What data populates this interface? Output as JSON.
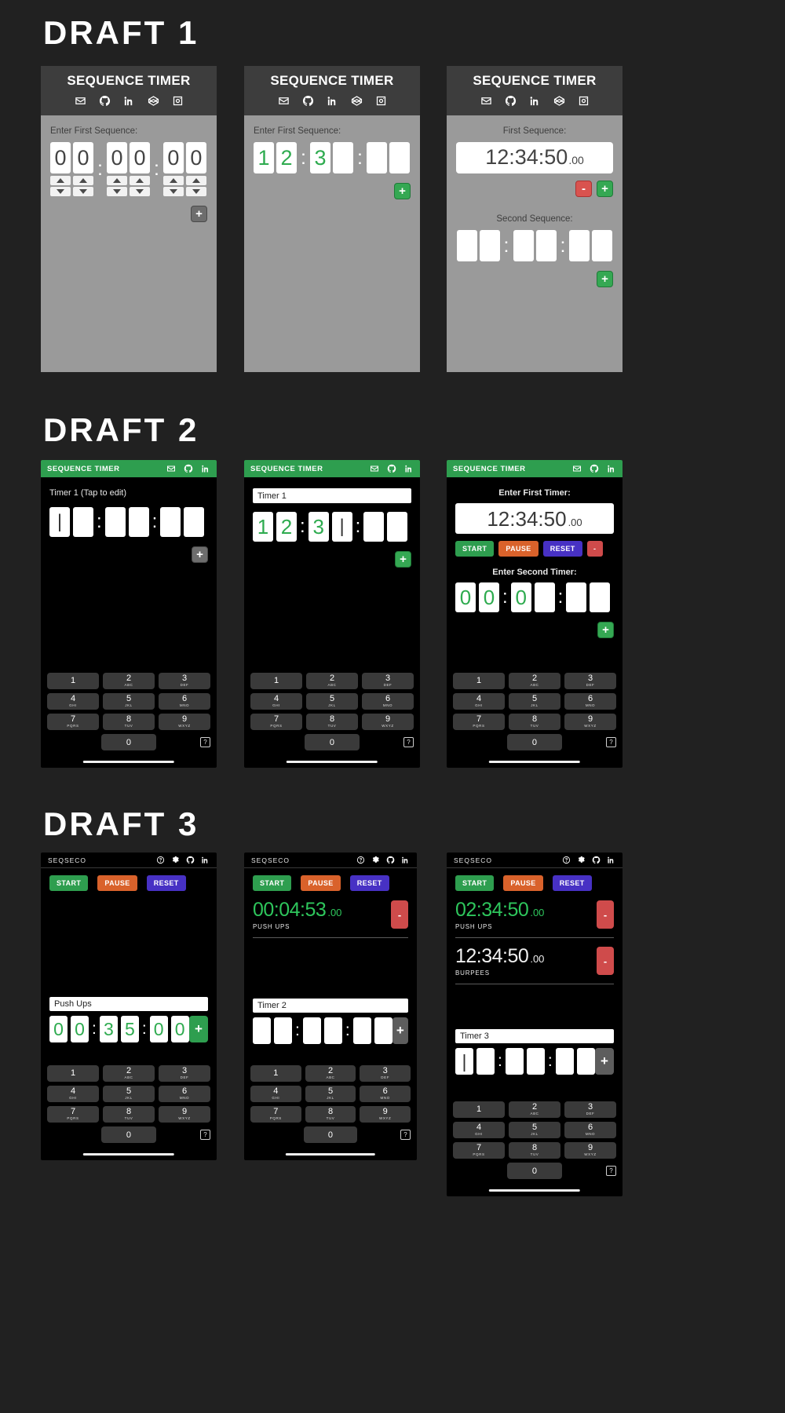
{
  "drafts": [
    {
      "title": "DRAFT 1"
    },
    {
      "title": "DRAFT 2"
    },
    {
      "title": "DRAFT 3"
    }
  ],
  "colors": {
    "page_bg": "#212121",
    "draft1_body": "#9a9a9a",
    "draft1_header": "#3d3d3d",
    "green": "#2e9e4f",
    "green_digit": "#2eab4f",
    "orange": "#d9622b",
    "purple": "#4731c4",
    "red": "#cf4b4b",
    "key_gray": "#3a3a3a",
    "timer_green": "#2ec65c"
  },
  "icons": {
    "mail": "mail-icon",
    "github": "github-icon",
    "linkedin": "linkedin-icon",
    "codepen": "codepen-icon",
    "instagram": "instagram-icon",
    "help": "help-circle-icon",
    "gear": "gear-icon"
  },
  "draft1": {
    "app_title": "SEQUENCE TIMER",
    "social": [
      "mail-icon",
      "github-icon",
      "linkedin-icon",
      "codepen-icon",
      "instagram-icon"
    ],
    "screens": [
      {
        "label": "Enter First Sequence:",
        "digits": [
          "0",
          "0",
          ":",
          "0",
          "0",
          ":",
          "0",
          "0"
        ],
        "has_spinners": true,
        "plus_label": "+",
        "plus_style": "gray"
      },
      {
        "label": "Enter First Sequence:",
        "digits": [
          "1",
          "2",
          ":",
          "3",
          "",
          ":",
          "",
          ""
        ],
        "filled": [
          true,
          true,
          false,
          true,
          false,
          false,
          false,
          false
        ],
        "has_spinners": false,
        "plus_label": "+",
        "plus_style": "green"
      },
      {
        "label_first": "First Sequence:",
        "display_main": "12:34:50",
        "display_frac": ".00",
        "minus_label": "-",
        "plus_label": "+",
        "label_second": "Second Sequence:",
        "digits2": [
          "",
          "",
          ":",
          "",
          "",
          ":",
          "",
          ""
        ],
        "plus2_label": "+"
      }
    ]
  },
  "draft2": {
    "app_title": "SEQUENCE TIMER",
    "social": [
      "mail-icon",
      "github-icon",
      "linkedin-icon"
    ],
    "keypad": {
      "keys": [
        {
          "num": "1",
          "sub": ""
        },
        {
          "num": "2",
          "sub": "ABC"
        },
        {
          "num": "3",
          "sub": "DEF"
        },
        {
          "num": "4",
          "sub": "GHI"
        },
        {
          "num": "5",
          "sub": "JKL"
        },
        {
          "num": "6",
          "sub": "MNO"
        },
        {
          "num": "7",
          "sub": "PQRS"
        },
        {
          "num": "8",
          "sub": "TUV"
        },
        {
          "num": "9",
          "sub": "WXYZ"
        }
      ],
      "zero": "0",
      "help": "?"
    },
    "screens": [
      {
        "hint": "Timer 1 (Tap to edit)",
        "digits": [
          "|",
          "",
          ":",
          "",
          "",
          ":",
          "",
          ""
        ],
        "plus_label": "+",
        "plus_style": "gray"
      },
      {
        "input_value": "Timer 1",
        "digits": [
          "1",
          "2",
          ":",
          "3",
          "|",
          ":",
          "",
          ""
        ],
        "green_flags": [
          true,
          true,
          false,
          true,
          false,
          false,
          false,
          false
        ],
        "plus_label": "+",
        "plus_style": "green"
      },
      {
        "label_first": "Enter First Timer:",
        "display_main": "12:34:50",
        "display_frac": ".00",
        "controls": [
          {
            "label": "START",
            "style": "start"
          },
          {
            "label": "PAUSE",
            "style": "pause"
          },
          {
            "label": "RESET",
            "style": "reset"
          },
          {
            "label": "-",
            "style": "minus"
          }
        ],
        "label_second": "Enter Second Timer:",
        "digits2": [
          "0",
          "0",
          ":",
          "0",
          "",
          ":",
          "",
          ""
        ],
        "green_flags2": [
          true,
          true,
          false,
          true,
          false,
          false,
          false,
          false
        ],
        "plus2_label": "+"
      }
    ]
  },
  "draft3": {
    "app_title": "SEQSECO",
    "header_icons": [
      "help-circle-icon",
      "gear-icon",
      "github-icon",
      "linkedin-icon"
    ],
    "controls": [
      {
        "label": "START",
        "style": "start"
      },
      {
        "label": "PAUSE",
        "style": "pause"
      },
      {
        "label": "RESET",
        "style": "reset"
      }
    ],
    "keypad": {
      "keys": [
        {
          "num": "1",
          "sub": ""
        },
        {
          "num": "2",
          "sub": "ABC"
        },
        {
          "num": "3",
          "sub": "DEF"
        },
        {
          "num": "4",
          "sub": "GHI"
        },
        {
          "num": "5",
          "sub": "JKL"
        },
        {
          "num": "6",
          "sub": "MNO"
        },
        {
          "num": "7",
          "sub": "PQRS"
        },
        {
          "num": "8",
          "sub": "TUV"
        },
        {
          "num": "9",
          "sub": "WXYZ"
        }
      ],
      "zero": "0",
      "help": "?"
    },
    "screens": [
      {
        "input_value": "Push Ups",
        "digits": [
          "0",
          "0",
          ":",
          "3",
          "5",
          ":",
          "0",
          "0"
        ],
        "green_flags": [
          true,
          true,
          false,
          true,
          true,
          false,
          true,
          true
        ],
        "plus_label": "+",
        "plus_style": "green"
      },
      {
        "timer_main": "00:04:53",
        "timer_frac": ".00",
        "timer_label": "PUSH UPS",
        "minus_label": "-",
        "input_value": "Timer 2",
        "digits": [
          "",
          "",
          ":",
          "",
          "",
          ":",
          "",
          ""
        ],
        "plus_label": "+",
        "plus_style": "gray"
      },
      {
        "timer1_main": "02:34:50",
        "timer1_frac": ".00",
        "timer1_label": "PUSH UPS",
        "minus1_label": "-",
        "timer2_main": "12:34:50",
        "timer2_frac": ".00",
        "timer2_label": "BURPEES",
        "minus2_label": "-",
        "input_value": "Timer 3",
        "digits": [
          "|",
          "",
          ":",
          "",
          "",
          ":",
          "",
          ""
        ],
        "plus_label": "+",
        "plus_style": "gray"
      }
    ]
  }
}
